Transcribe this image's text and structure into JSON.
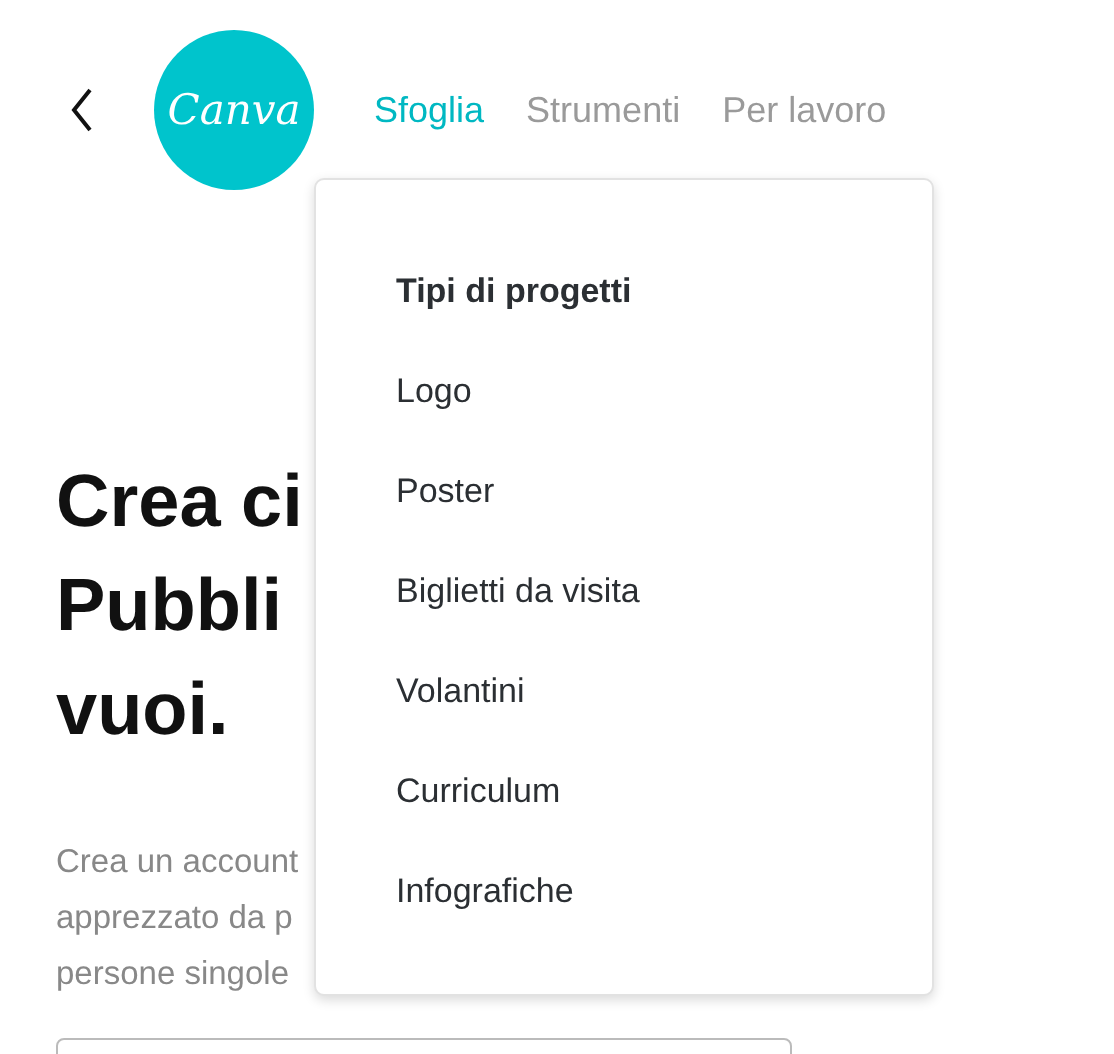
{
  "logo": {
    "text": "Canva"
  },
  "nav": [
    {
      "label": "Sfoglia",
      "selected": true
    },
    {
      "label": "Strumenti",
      "selected": false
    },
    {
      "label": "Per lavoro",
      "selected": false
    }
  ],
  "headline": [
    "Crea ci",
    "Pubbli",
    "vuoi."
  ],
  "intro": [
    "Crea un account",
    "apprezzato da p",
    "persone singole"
  ],
  "dropdown": {
    "title": "Tipi di progetti",
    "items": [
      "Logo",
      "Poster",
      "Biglietti da visita",
      "Volantini",
      "Curriculum",
      "Infografiche"
    ]
  }
}
